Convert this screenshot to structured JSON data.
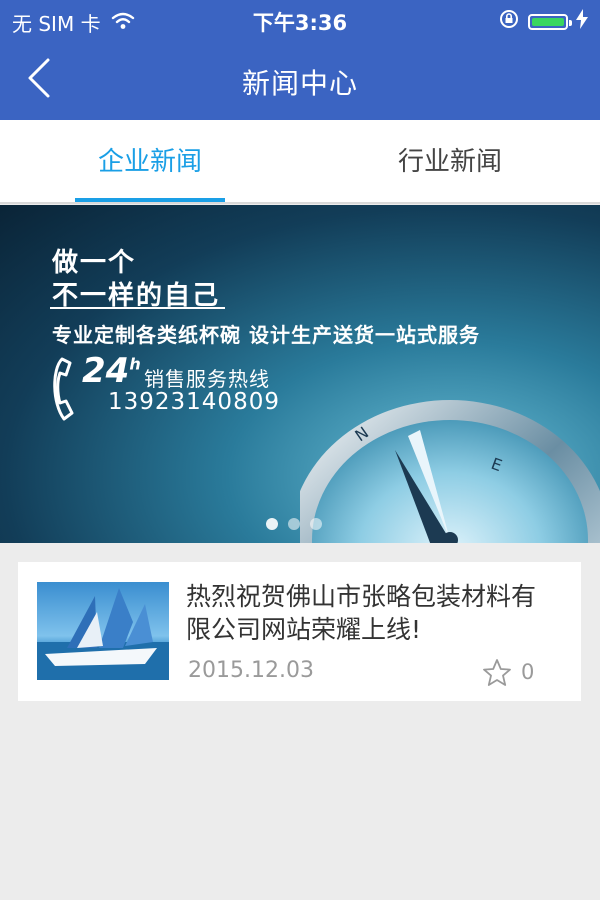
{
  "status_bar": {
    "carrier": "无 SIM 卡",
    "time": "下午3:36",
    "battery_level": 1.0,
    "battery_color": "#39d65f"
  },
  "nav": {
    "title": "新闻中心",
    "back_icon": "chevron-left-icon"
  },
  "tabs": [
    {
      "label": "企业新闻",
      "active": true
    },
    {
      "label": "行业新闻",
      "active": false
    }
  ],
  "banner": {
    "line1": "做一个",
    "line2": "不一样的自己",
    "service": "专业定制各类纸杯碗  设计生产送货一站式服务",
    "hours": "24",
    "hours_sup": "h",
    "hotline_label": "销售服务热线",
    "phone": "13923140809",
    "slide_count": 3,
    "active_slide": 0
  },
  "news": [
    {
      "title": "热烈祝贺佛山市张略包装材料有限公司网站荣耀上线!",
      "date": "2015.12.03",
      "likes": "0",
      "thumb_icon": "sailboat-image"
    }
  ],
  "colors": {
    "nav_bg": "#3b64c2",
    "accent": "#1a9fe6",
    "page_bg": "#ececec"
  }
}
